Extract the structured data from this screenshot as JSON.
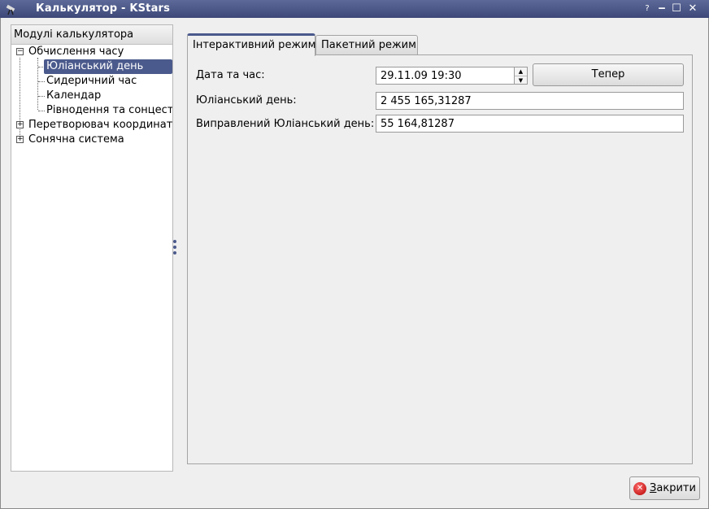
{
  "window": {
    "title": "Калькулятор - KStars",
    "help_glyph": "?",
    "minimize_glyph": "‒",
    "maximize_glyph": "☐",
    "close_glyph": "✕"
  },
  "tree": {
    "header": "Модулі калькулятора",
    "items": [
      {
        "label": "Обчислення часу",
        "expanded": true
      },
      {
        "label": "Юліанський день",
        "selected": true
      },
      {
        "label": "Сидеричний час"
      },
      {
        "label": "Календар"
      },
      {
        "label": "Рівнодення та сонцестояння"
      },
      {
        "label": "Перетворювач координат",
        "expanded": false
      },
      {
        "label": "Сонячна система",
        "expanded": false
      }
    ]
  },
  "tabs": {
    "interactive": "Інтерактивний режим",
    "batch": "Пакетний режим"
  },
  "form": {
    "datetime_label": "Дата та час:",
    "datetime_value": "29.11.09 19:30",
    "now_button": "Тепер",
    "jd_label": "Юліанський день:",
    "jd_value": "2 455 165,31287",
    "mjd_label": "Виправлений Юліанський день:",
    "mjd_value": "55 164,81287"
  },
  "footer": {
    "close_button": "Закрити",
    "close_underline": "З"
  },
  "icons": {
    "app": "telescope-icon",
    "close": "close-circle-icon"
  },
  "colors": {
    "titlebar": "#4a5687",
    "selection": "#4b5a8c"
  }
}
